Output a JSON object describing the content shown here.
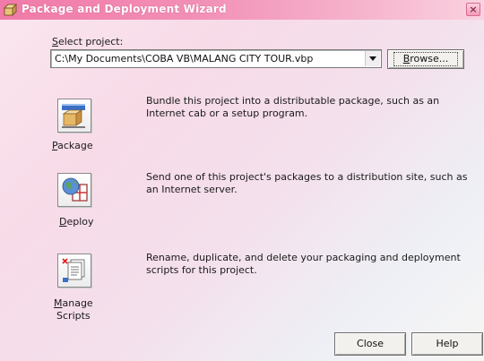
{
  "window": {
    "title": "Package and Deployment Wizard",
    "close_glyph": "×"
  },
  "project": {
    "label_mnemonic": "S",
    "label_rest": "elect project:",
    "path": "C:\\My Documents\\COBA VB\\MALANG CITY TOUR.vbp",
    "browse_mnemonic": "B",
    "browse_rest": "rowse..."
  },
  "actions": [
    {
      "id": "package",
      "label_mnemonic": "P",
      "label_rest": "ackage",
      "description": "Bundle this project into a distributable package, such as an Internet cab or a setup program.",
      "icon": "package-icon"
    },
    {
      "id": "deploy",
      "label_mnemonic": "D",
      "label_rest": "eploy",
      "description": "Send one of this project's packages to a distribution site, such as an Internet server.",
      "icon": "deploy-icon"
    },
    {
      "id": "manage-scripts",
      "label_mnemonic": "M",
      "label_rest": "anage",
      "label_line2": "Scripts",
      "description": "Rename, duplicate, and delete your packaging and deployment scripts for this project.",
      "icon": "manage-scripts-icon"
    }
  ],
  "footer": {
    "close_label": "Close",
    "help_label": "Help"
  },
  "colors": {
    "titlebar_start": "#f07aa8",
    "titlebar_end": "#fad2e0",
    "background_tint": "#f7dbe8"
  }
}
